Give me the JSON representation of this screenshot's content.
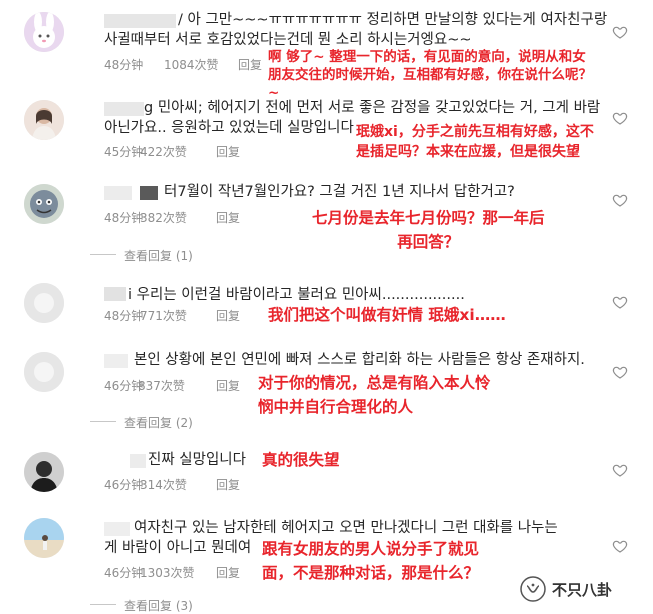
{
  "comments": [
    {
      "line1": "/ 아 그만~~~ㅠㅠㅠㅠㅠㅠㅠ 정리하면 만날의향 있다는게 여자친구랑",
      "line2": "사귈때부터 서로 호감있었다는건데 뭔 소리 하시는거엥요~~",
      "time": "48分钟",
      "likes": "1084次赞",
      "reply": "回复",
      "translation": "啊 够了~ 整理一下的话，有见面的意向，说明从和女\n朋友交往的时候开始，互相都有好感，你在说什么呢？\n~",
      "avatar": "bunny-avatar"
    },
    {
      "line1": "g 민아씨; 헤어지기 전에 먼저 서로 좋은 감정을 갖고있었다는 거, 그게 바람",
      "line2": "아닌가요.. 응원하고 있었는데 실망입니다",
      "time": "45分钟",
      "likes": "422次赞",
      "reply": "回复",
      "translation": "珉娥xi，分手之前先互相有好感，这不\n是插足吗？本来在应援，但是很失望",
      "avatar": "girl-avatar"
    },
    {
      "line1": "터7월이 작년7월인가요? 그걸 거진 1년 지나서 답한거고?",
      "time": "48分钟",
      "likes": "382次赞",
      "reply": "回复",
      "view_replies": "查看回复 (1)",
      "translation": "七月份是去年七月份吗？那一年后\n再回答？",
      "avatar": "cartoon-avatar"
    },
    {
      "line1": "i 우리는 이런걸 바람이라고 불러요 민아씨..................",
      "time": "48分钟",
      "likes": "771次赞",
      "reply": "回复",
      "translation": "我们把这个叫做有奸情 珉娥xi……",
      "avatar": "default-avatar"
    },
    {
      "line1": "본인 상황에 본인 연민에 빠져 스스로 합리화 하는 사람들은 항상 존재하지.",
      "time": "46分钟",
      "likes": "837次赞",
      "reply": "回复",
      "view_replies": "查看回复 (2)",
      "translation": "对于你的情况，总是有陷入本人怜\n悯中并自行合理化的人",
      "avatar": "default-avatar"
    },
    {
      "line1": "진짜 실망입니다",
      "time": "46分钟",
      "likes": "314次赞",
      "reply": "回复",
      "translation": "真的很失望",
      "avatar": "dark-avatar"
    },
    {
      "line1": "여자친구 있는 남자한테 헤어지고 오면 만나겠다니 그런 대화를 나누는",
      "line2": "게 바람이 아니고 뭔데여",
      "time": "46分钟",
      "likes": "1303次赞",
      "reply": "回复",
      "view_replies": "查看回复 (3)",
      "translation": "跟有女朋友的男人说分手了就见\n面，不是那种对话，那是什么？",
      "avatar": "beach-avatar"
    }
  ],
  "watermark": {
    "text": "不只八卦",
    "icon": "wechat-channel-icon"
  },
  "colors": {
    "translation": "#e8252c",
    "meta": "#8e8e8e",
    "text": "#262626"
  }
}
